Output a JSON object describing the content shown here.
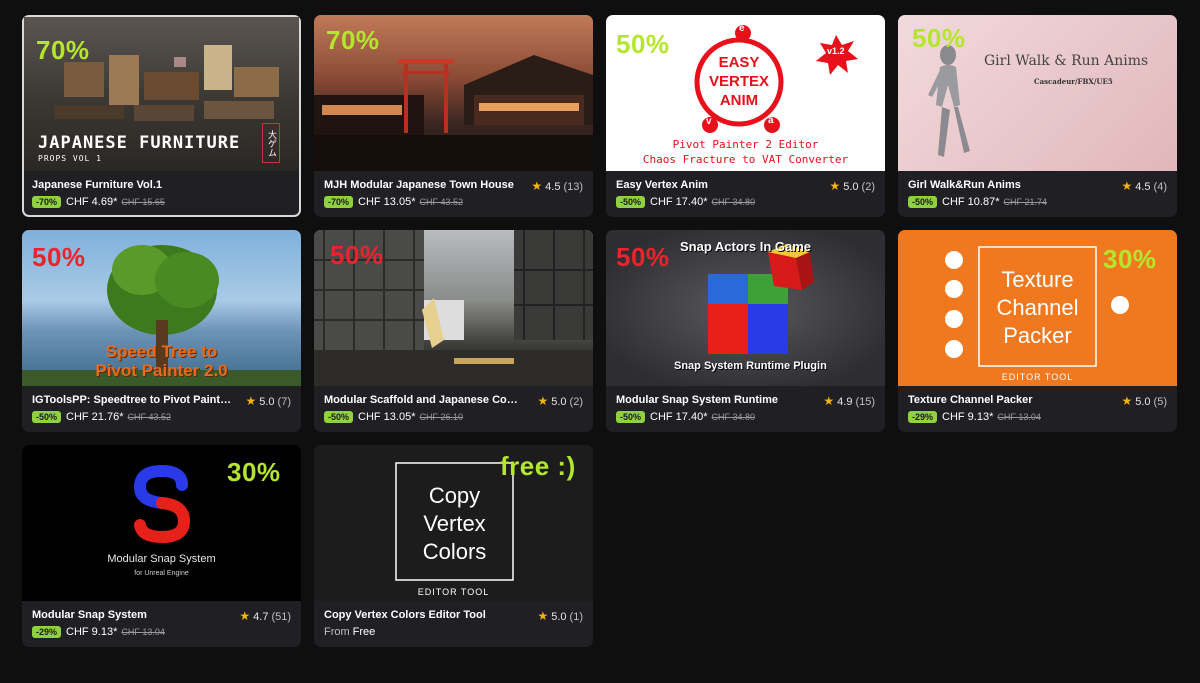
{
  "cards": [
    {
      "pct": "70%",
      "title": "Japanese Furniture Vol.1",
      "rating": "",
      "count": "",
      "badge": "-70%",
      "price": "CHF 4.69*",
      "old": "CHF 15.65",
      "art": {
        "title": "JAPANESE FURNITURE",
        "sub": "PROPS VOL 1",
        "stamp": "大ゲム"
      }
    },
    {
      "pct": "70%",
      "title": "MJH Modular Japanese Town House",
      "rating": "4.5",
      "count": "(13)",
      "badge": "-70%",
      "price": "CHF 13.05*",
      "old": "CHF 43.52"
    },
    {
      "pct": "50%",
      "title": "Easy Vertex Anim",
      "rating": "5.0",
      "count": "(2)",
      "badge": "-50%",
      "price": "CHF 17.40*",
      "old": "CHF 34.80",
      "art": {
        "l1": "EASY",
        "l2": "VERTEX",
        "l3": "ANIM",
        "e": "e",
        "v": "v",
        "a": "a",
        "ver": "v1.2",
        "sub1": "Pivot Painter 2 Editor",
        "sub2": "Chaos Fracture to VAT Converter"
      }
    },
    {
      "pct": "50%",
      "title": "Girl Walk&Run Anims",
      "rating": "4.5",
      "count": "(4)",
      "badge": "-50%",
      "price": "CHF 10.87*",
      "old": "CHF 21.74",
      "art": {
        "title": "Girl Walk & Run Anims",
        "sub": "Cascadeur/FBX/UE5"
      }
    },
    {
      "pct": "50%",
      "title": "IGToolsPP: Speedtree to Pivot Painter 2...",
      "rating": "5.0",
      "count": "(7)",
      "badge": "-50%",
      "price": "CHF 21.76*",
      "old": "CHF 43.52",
      "art": {
        "l1": "Speed Tree to",
        "l2": "Pivot Painter 2.0"
      }
    },
    {
      "pct": "50%",
      "title": "Modular Scaffold and Japanese Constr...",
      "rating": "5.0",
      "count": "(2)",
      "badge": "-50%",
      "price": "CHF 13.05*",
      "old": "CHF 26.10"
    },
    {
      "pct": "50%",
      "title": "Modular Snap System Runtime",
      "rating": "4.9",
      "count": "(15)",
      "badge": "-50%",
      "price": "CHF 17.40*",
      "old": "CHF 34.80",
      "art": {
        "top": "Snap Actors In Game",
        "bottom": "Snap System Runtime Plugin"
      }
    },
    {
      "pct": "30%",
      "title": "Texture Channel Packer",
      "rating": "5.0",
      "count": "(5)",
      "badge": "-29%",
      "price": "CHF 9.13*",
      "old": "CHF 13.04",
      "art": {
        "l1": "Texture",
        "l2": "Channel",
        "l3": "Packer",
        "sub": "EDITOR TOOL"
      }
    },
    {
      "pct": "30%",
      "title": "Modular Snap System",
      "rating": "4.7",
      "count": "(51)",
      "badge": "-29%",
      "price": "CHF 9.13*",
      "old": "CHF 13.04",
      "art": {
        "l1": "Modular Snap System",
        "l2": "for Unreal Engine"
      }
    },
    {
      "pct": "free :)",
      "title": "Copy Vertex Colors Editor Tool",
      "rating": "5.0",
      "count": "(1)",
      "from": "From",
      "price": "Free",
      "art": {
        "l1": "Copy",
        "l2": "Vertex",
        "l3": "Colors",
        "sub": "EDITOR TOOL"
      }
    }
  ]
}
